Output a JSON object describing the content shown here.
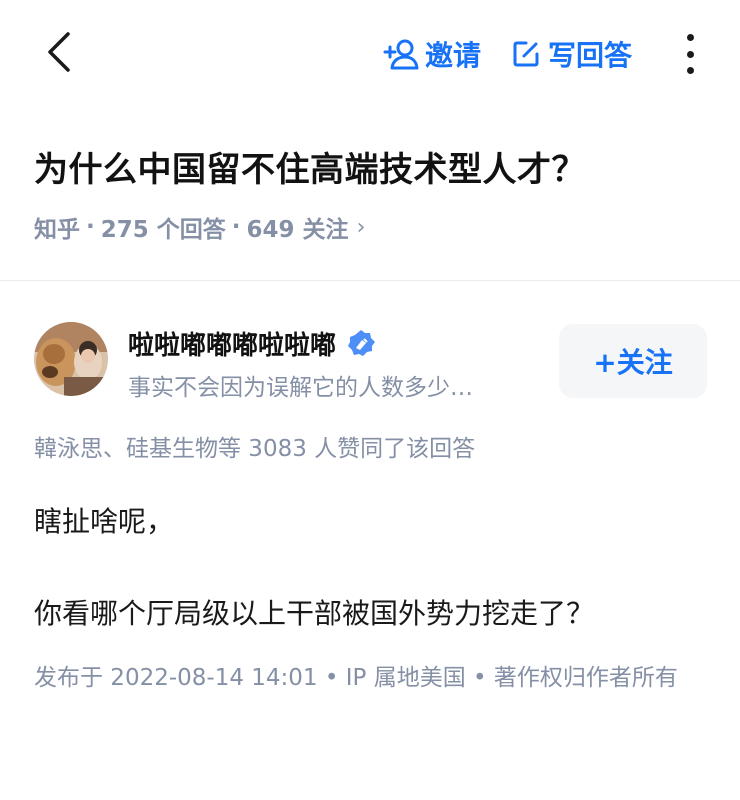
{
  "topbar": {
    "back_icon": "chevron-left-icon",
    "invite_icon": "add-user-icon",
    "invite_label": "邀请",
    "write_icon": "edit-icon",
    "write_label": "写回答",
    "more_icon": "more-vertical-icon"
  },
  "question": {
    "title": "为什么中国留不住高端技术型人才？",
    "source": "知乎",
    "answers": "275 个回答",
    "followers": "649 关注",
    "separator": "·",
    "chevron": "›"
  },
  "answer": {
    "author": {
      "name": "啦啦嘟嘟嘟啦啦嘟",
      "bio": "事实不会因为误解它的人数多少…",
      "badge_icon": "verified-badge-icon",
      "follow_label": "+关注"
    },
    "votes": "韓泳思、硅基生物等 3083 人赞同了该回答",
    "paragraphs": [
      "瞎扯啥呢，",
      "你看哪个厅局级以上干部被国外势力挖走了？"
    ],
    "publish_info": "发布于 2022-08-14 14:01 • IP 属地美国 • 著作权归作者所有"
  },
  "colors": {
    "accent": "#1772f6",
    "meta_gray": "#8590a6",
    "text": "#1a1a1a",
    "button_bg": "#f5f6f7"
  }
}
